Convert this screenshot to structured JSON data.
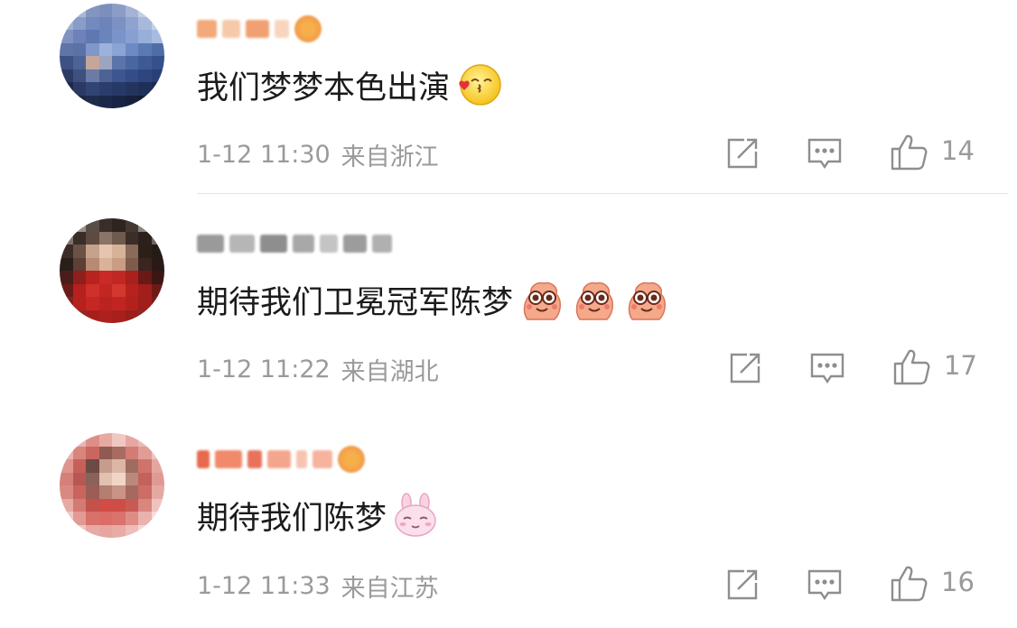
{
  "comments": [
    {
      "text": "我们梦梦本色出演",
      "emoji": "kiss-emoji",
      "date": "1-12 11:30",
      "location": "来自浙江",
      "likes": "14"
    },
    {
      "text": "期待我们卫冕冠军陈梦",
      "emoji": "sparkle-eyes-emoji",
      "date": "1-12 11:22",
      "location": "来自湖北",
      "likes": "17"
    },
    {
      "text": "期待我们陈梦",
      "emoji": "bunny-emoji",
      "date": "1-12 11:33",
      "location": "来自江苏",
      "likes": "16"
    }
  ],
  "icons": {
    "repost": "repost-icon",
    "comment": "comment-icon",
    "like": "thumbs-up-icon"
  },
  "colors": {
    "text": "#1b1b1b",
    "meta": "#9a9a9a",
    "divider": "#e6e6e6"
  }
}
